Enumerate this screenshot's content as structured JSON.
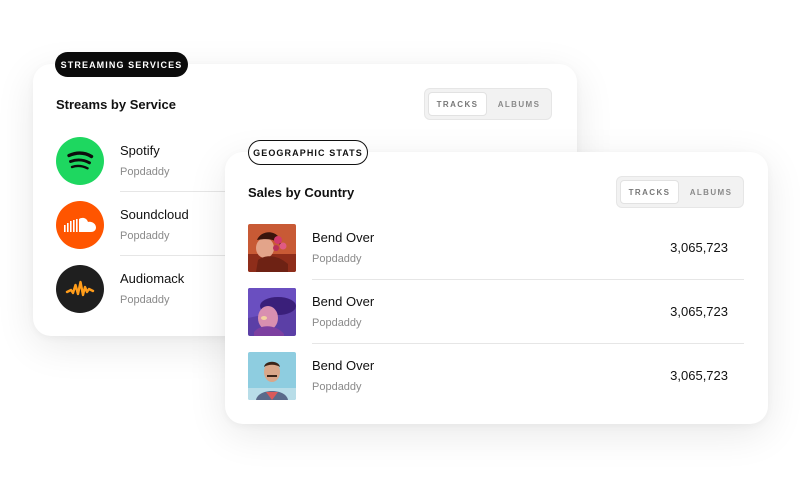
{
  "streaming": {
    "badge": "STREAMING SERVICES",
    "title": "Streams by Service",
    "toggle": {
      "tracks_label": "TRACKS",
      "albums_label": "ALBUMS",
      "active": "TRACKS"
    },
    "services": [
      {
        "name": "Spotify",
        "subtitle": "Popdaddy",
        "icon": "spotify-icon",
        "color": "#1ed760"
      },
      {
        "name": "Soundcloud",
        "subtitle": "Popdaddy",
        "icon": "soundcloud-icon",
        "color": "#ff5500"
      },
      {
        "name": "Audiomack",
        "subtitle": "Popdaddy",
        "icon": "audiomack-icon",
        "color": "#1f1f1f"
      }
    ]
  },
  "geo": {
    "badge": "GEOGRAPHIC STATS",
    "title": "Sales by Country",
    "toggle": {
      "tracks_label": "TRACKS",
      "albums_label": "ALBUMS",
      "active": "TRACKS"
    },
    "rows": [
      {
        "title": "Bend Over",
        "subtitle": "Popdaddy",
        "value": "3,065,723"
      },
      {
        "title": "Bend Over",
        "subtitle": "Popdaddy",
        "value": "3,065,723"
      },
      {
        "title": "Bend Over",
        "subtitle": "Popdaddy",
        "value": "3,065,723"
      }
    ]
  },
  "colors": {
    "badge_dark": "#0b0b0b",
    "divider": "#e6e6e6",
    "muted_text": "#8a8a8a"
  }
}
